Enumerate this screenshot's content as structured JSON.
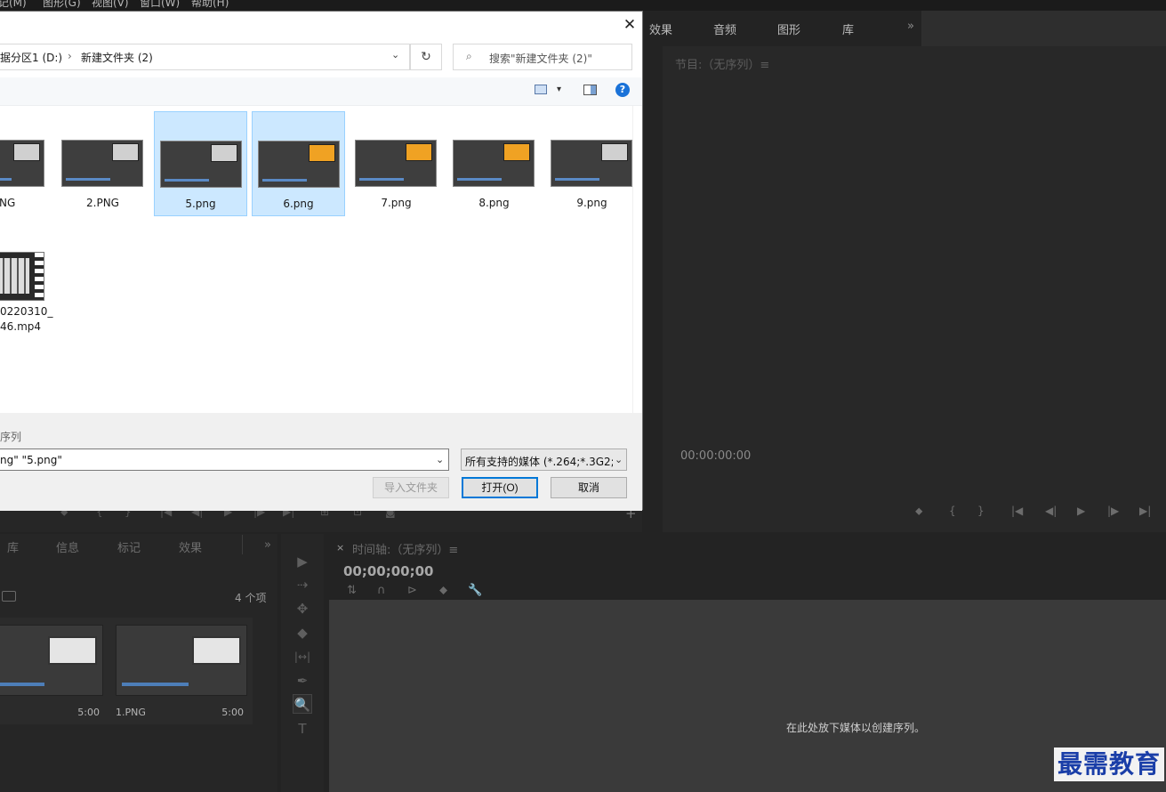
{
  "menubar": {
    "items": [
      "记(M)",
      "图形(G)",
      "视图(V)",
      "窗口(W)",
      "帮助(H)"
    ]
  },
  "workspace": {
    "tabs": [
      "效果",
      "音频",
      "图形",
      "库"
    ],
    "more": "»"
  },
  "program": {
    "title": "节目:（无序列）≡",
    "timecode": "00:00:00:00",
    "controls": [
      "⬥",
      "{",
      "}",
      "|◀",
      "◀|",
      "▶",
      "|▶",
      "▶|"
    ]
  },
  "source_controls": [
    "⬥",
    "{",
    "}",
    "|◀",
    "◀|",
    "▶",
    "|▶",
    "▶|",
    "⊞",
    "⊡",
    "◙"
  ],
  "source_plus": "+",
  "project": {
    "tabs": [
      "库",
      "信息",
      "标记",
      "效果"
    ],
    "more": "»",
    "count": "4 个项",
    "clips": [
      {
        "name": "",
        "duration": "5:00"
      },
      {
        "name": "1.PNG",
        "duration": "5:00"
      }
    ]
  },
  "tools": [
    "▶",
    "⇢",
    "✥",
    "◆",
    "|↔|",
    "✒",
    "🔍",
    "T"
  ],
  "timeline": {
    "close": "×",
    "title": "时间轴:（无序列）≡",
    "timecode": "00;00;00;00",
    "tools": [
      "⇅",
      "∩",
      "⊳",
      "⬥",
      "🔧"
    ],
    "drop_hint": "在此处放下媒体以创建序列。"
  },
  "watermark": "最需教育",
  "dialog": {
    "close": "✕",
    "breadcrumb": [
      "据分区1 (D:)",
      "›",
      "新建文件夹 (2)"
    ],
    "breadcrumb_drop": "⌄",
    "refresh": "↻",
    "search_placeholder": "搜索\"新建文件夹 (2)\"",
    "search_icon": "⌕",
    "help": "?",
    "view_drop": "▾",
    "files": [
      {
        "name": "PNG",
        "selected": false,
        "accent": false
      },
      {
        "name": "2.PNG",
        "selected": false,
        "accent": false
      },
      {
        "name": "5.png",
        "selected": true,
        "accent": false
      },
      {
        "name": "6.png",
        "selected": true,
        "accent": true
      },
      {
        "name": "7.png",
        "selected": false,
        "accent": true
      },
      {
        "name": "8.png",
        "selected": false,
        "accent": true
      },
      {
        "name": "9.png",
        "selected": false,
        "accent": false
      }
    ],
    "video_file": {
      "line1": "0220310_",
      "line2": "46.mp4"
    },
    "sequence_label": "序列",
    "filename_value": "ng\" \"5.png\"",
    "filetype_value": "所有支持的媒体 (*.264;*.3G2;*",
    "dropdown": "⌄",
    "import_folder": "导入文件夹",
    "open": "打开(O)",
    "cancel": "取消"
  }
}
